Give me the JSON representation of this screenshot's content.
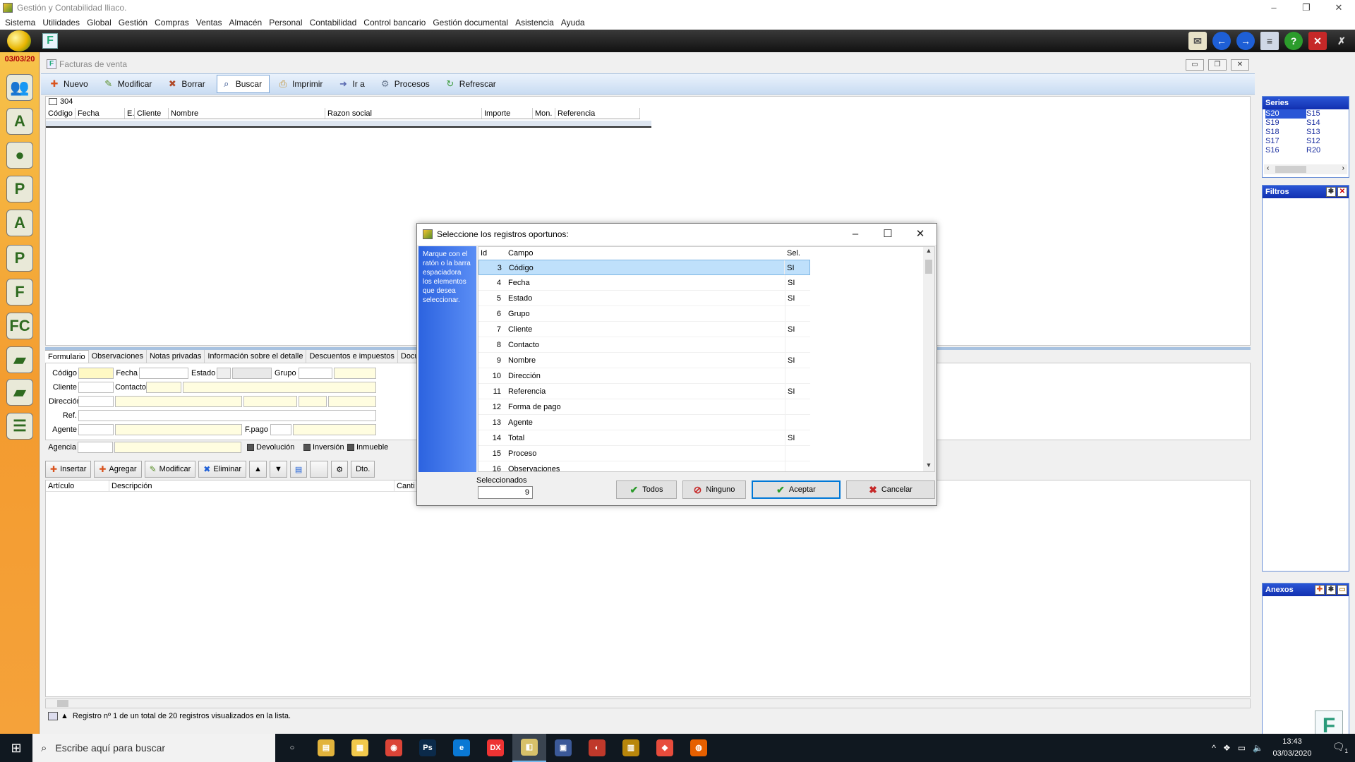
{
  "window": {
    "title": "Gestión y Contabilidad Iliaco.",
    "controls": [
      "–",
      "❐",
      "✕"
    ]
  },
  "menu": [
    "Sistema",
    "Utilidades",
    "Global",
    "Gestión",
    "Compras",
    "Ventas",
    "Almacén",
    "Personal",
    "Contabilidad",
    "Control bancario",
    "Gestión documental",
    "Asistencia",
    "Ayuda"
  ],
  "rail": {
    "date": "03/03/20",
    "icons": [
      "users-icon",
      "clients-icon",
      "person-icon",
      "person-p-icon",
      "person-a-icon",
      "p-icon",
      "f-icon",
      "fc-icon",
      "bag-icon",
      "box-icon",
      "list-icon"
    ],
    "glyphs": [
      "👥",
      "A",
      "●",
      "P",
      "A",
      "P",
      "F",
      "FC",
      "▰",
      "▰",
      "☰"
    ]
  },
  "child": {
    "title": "Facturas de venta",
    "record_id": "304"
  },
  "toolbar": {
    "buttons": [
      {
        "label": "Nuevo",
        "icon": "new-icon",
        "glyph": "✚",
        "color": "#d9531e"
      },
      {
        "label": "Modificar",
        "icon": "edit-icon",
        "glyph": "✎",
        "color": "#5a8f29"
      },
      {
        "label": "Borrar",
        "icon": "delete-icon",
        "glyph": "✖",
        "color": "#b04a2a"
      },
      {
        "label": "Buscar",
        "icon": "search-icon",
        "glyph": "⌕",
        "color": "#1a3c80"
      },
      {
        "label": "Imprimir",
        "icon": "print-icon",
        "glyph": "⎙",
        "color": "#c08a20"
      },
      {
        "label": "Ir a",
        "icon": "goto-icon",
        "glyph": "➜",
        "color": "#5a6ab0"
      },
      {
        "label": "Procesos",
        "icon": "process-icon",
        "glyph": "⚙",
        "color": "#6a7a90"
      },
      {
        "label": "Refrescar",
        "icon": "refresh-icon",
        "glyph": "↻",
        "color": "#3a9a3a"
      }
    ],
    "active": "Buscar"
  },
  "grid": {
    "columns": [
      "Código",
      "Fecha",
      "E.",
      "Cliente",
      "Nombre",
      "Razon social",
      "Importe",
      "Mon.",
      "Referencia"
    ]
  },
  "tabs": [
    "Formulario",
    "Observaciones",
    "Notas privadas",
    "Información sobre el detalle",
    "Descuentos e impuestos",
    "Docu"
  ],
  "form": {
    "codigo": "Código",
    "fecha": "Fecha",
    "estado": "Estado",
    "grupo": "Grupo",
    "cliente": "Cliente",
    "contacto": "Contacto",
    "direccion": "Dirección",
    "ref": "Ref.",
    "agente": "Agente",
    "fpago": "F.pago",
    "agencia": "Agencia",
    "devolucion": "Devolución",
    "inversion": "Inversión",
    "inmueble": "Inmueble"
  },
  "detail_toolbar": {
    "insertar": "Insertar",
    "agregar": "Agregar",
    "modificar": "Modificar",
    "eliminar": "Eliminar",
    "dto": "Dto."
  },
  "detail_grid": {
    "columns": [
      "Artículo",
      "Descripción",
      "Canti"
    ]
  },
  "status": {
    "text": "Registro nº 1 de un total de 20 registros visualizados en la lista."
  },
  "series": {
    "title": "Series",
    "items": [
      "S20",
      "S15",
      "S19",
      "S14",
      "S18",
      "S13",
      "S17",
      "S12",
      "S16",
      "R20"
    ],
    "selected": "S20"
  },
  "filtros": {
    "title": "Filtros"
  },
  "anexos": {
    "title": "Anexos"
  },
  "dialog": {
    "title": "Seleccione los registros oportunos:",
    "hint": "Marque con el ratón o la barra espaciadora los elementos que desea seleccionar.",
    "columns": {
      "id": "Id",
      "campo": "Campo",
      "sel": "Sel."
    },
    "rows": [
      {
        "id": "3",
        "campo": "Código",
        "sel": "SI"
      },
      {
        "id": "4",
        "campo": "Fecha",
        "sel": "SI"
      },
      {
        "id": "5",
        "campo": "Estado",
        "sel": "SI"
      },
      {
        "id": "6",
        "campo": "Grupo",
        "sel": ""
      },
      {
        "id": "7",
        "campo": "Cliente",
        "sel": "SI"
      },
      {
        "id": "8",
        "campo": "Contacto",
        "sel": ""
      },
      {
        "id": "9",
        "campo": "Nombre",
        "sel": "SI"
      },
      {
        "id": "10",
        "campo": "Dirección",
        "sel": ""
      },
      {
        "id": "11",
        "campo": "Referencia",
        "sel": "SI"
      },
      {
        "id": "12",
        "campo": "Forma de pago",
        "sel": ""
      },
      {
        "id": "13",
        "campo": "Agente",
        "sel": ""
      },
      {
        "id": "14",
        "campo": "Total",
        "sel": "SI"
      },
      {
        "id": "15",
        "campo": "Proceso",
        "sel": ""
      },
      {
        "id": "16",
        "campo": "Observaciones",
        "sel": ""
      }
    ],
    "selected_label": "Seleccionados",
    "selected_count": "9",
    "buttons": {
      "todos": "Todos",
      "ninguno": "Ninguno",
      "aceptar": "Aceptar",
      "cancelar": "Cancelar"
    }
  },
  "taskbar": {
    "search_placeholder": "Escribe aquí para buscar",
    "apps": [
      {
        "name": "task-view",
        "glyph": "○",
        "bg": "transparent"
      },
      {
        "name": "folder",
        "glyph": "▤",
        "bg": "#e2b33c"
      },
      {
        "name": "file-explorer",
        "glyph": "▦",
        "bg": "#f2c94c"
      },
      {
        "name": "chrome",
        "glyph": "◉",
        "bg": "#db4437"
      },
      {
        "name": "photoshop",
        "glyph": "Ps",
        "bg": "#0b2a4a"
      },
      {
        "name": "edge",
        "glyph": "e",
        "bg": "#0a78d4"
      },
      {
        "name": "dx",
        "glyph": "DX",
        "bg": "#e33"
      },
      {
        "name": "iliaco",
        "glyph": "◧",
        "bg": "#d8c16a"
      },
      {
        "name": "monitor",
        "glyph": "▣",
        "bg": "#3b5998"
      },
      {
        "name": "app-red",
        "glyph": "◐",
        "bg": "#c0392b"
      },
      {
        "name": "app-gold",
        "glyph": "▥",
        "bg": "#b8860b"
      },
      {
        "name": "anydesk",
        "glyph": "◆",
        "bg": "#e74c3c"
      },
      {
        "name": "firefox",
        "glyph": "◍",
        "bg": "#e66000"
      }
    ],
    "tray": [
      "^",
      "❖",
      "▭",
      "🔈"
    ],
    "time": "13:43",
    "date": "03/03/2020",
    "notifications": "1"
  }
}
